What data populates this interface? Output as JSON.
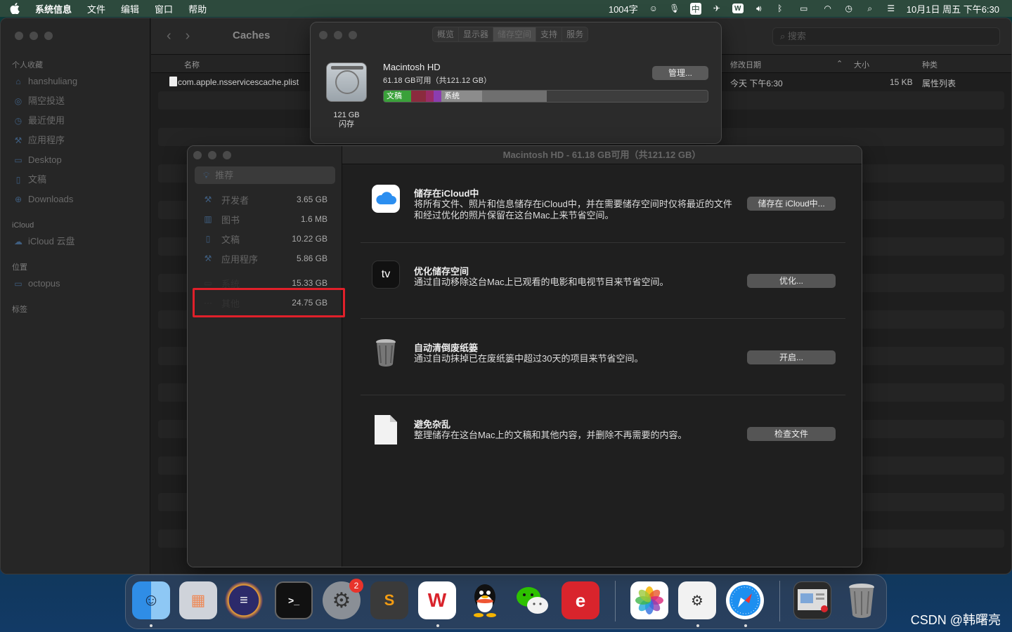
{
  "menubar": {
    "app_name": "系统信息",
    "items": [
      "文件",
      "编辑",
      "窗口",
      "帮助"
    ],
    "status": {
      "word_count": "1004字",
      "input_method": "中",
      "datetime": "10月1日 周五 下午6:30"
    }
  },
  "finder": {
    "title": "Caches",
    "search_placeholder": "搜索",
    "sidebar": {
      "favorites_label": "个人收藏",
      "favorites": [
        {
          "label": "hanshuliang",
          "icon": "home-icon"
        },
        {
          "label": "隔空投送",
          "icon": "airdrop-icon"
        },
        {
          "label": "最近使用",
          "icon": "clock-icon"
        },
        {
          "label": "应用程序",
          "icon": "apps-icon"
        },
        {
          "label": "Desktop",
          "icon": "desktop-icon"
        },
        {
          "label": "文稿",
          "icon": "document-icon"
        },
        {
          "label": "Downloads",
          "icon": "download-icon"
        }
      ],
      "icloud_label": "iCloud",
      "icloud": [
        {
          "label": "iCloud 云盘",
          "icon": "cloud-icon"
        }
      ],
      "locations_label": "位置",
      "locations": [
        {
          "label": "octopus",
          "icon": "computer-icon"
        }
      ],
      "tags_label": "标签"
    },
    "columns": {
      "name": "名称",
      "date": "修改日期",
      "size": "大小",
      "kind": "种类"
    },
    "file": {
      "name": "com.apple.nsservicescache.plist",
      "date": "今天 下午6:30",
      "size": "15 KB",
      "kind": "属性列表"
    }
  },
  "about": {
    "tabs": [
      "概览",
      "显示器",
      "储存空间",
      "支持",
      "服务"
    ],
    "active_tab": "储存空间",
    "disk_capacity": "121 GB",
    "disk_type": "闪存",
    "disk_name": "Macintosh HD",
    "disk_free": "61.18 GB可用（共121.12 GB）",
    "manage_button": "管理...",
    "bar_labels": {
      "documents": "文稿",
      "system": "系统"
    },
    "bar_fractions": {
      "documents": 0.084,
      "other_a": 0.047,
      "other_b": 0.023,
      "purple": 0.024,
      "system": 0.126,
      "apps": 0.2
    },
    "colors": {
      "documents": "#3aa13a",
      "red": "#8b2b3e",
      "pink": "#9a2c66",
      "purple": "#8b3db0",
      "system": "#8c8c8c",
      "apps": "#6f6f6f"
    }
  },
  "storage": {
    "title": "Macintosh HD - 61.18 GB可用（共121.12 GB）",
    "recommended": "推荐",
    "categories": [
      {
        "name": "开发者",
        "size": "3.65 GB",
        "icon": "hammer-icon"
      },
      {
        "name": "图书",
        "size": "1.6 MB",
        "icon": "book-icon"
      },
      {
        "name": "文稿",
        "size": "10.22 GB",
        "icon": "document-icon"
      },
      {
        "name": "应用程序",
        "size": "5.86 GB",
        "icon": "apps-icon"
      },
      {
        "name": "系统",
        "size": "15.33 GB",
        "icon": "system-icon"
      },
      {
        "name": "其他",
        "size": "24.75 GB",
        "icon": "more-icon"
      }
    ],
    "recommendations": [
      {
        "title": "储存在iCloud中",
        "desc": "将所有文件、照片和信息储存在iCloud中，并在需要储存空间时仅将最近的文件和经过优化的照片保留在这台Mac上来节省空间。",
        "button": "储存在 iCloud中...",
        "icon": "icloud-icon"
      },
      {
        "title": "优化储存空间",
        "desc": "通过自动移除这台Mac上已观看的电影和电视节目来节省空间。",
        "button": "优化...",
        "icon": "appletv-icon"
      },
      {
        "title": "自动清倒废纸篓",
        "desc": "通过自动抹掉已在废纸篓中超过30天的项目来节省空间。",
        "button": "开启...",
        "icon": "trash-icon"
      },
      {
        "title": "避免杂乱",
        "desc": "整理储存在这台Mac上的文稿和其他内容，并删除不再需要的内容。",
        "button": "检查文件",
        "icon": "file-icon"
      }
    ],
    "tv_glyph": "tv"
  },
  "dock": {
    "settings_badge": "2",
    "apps": [
      "finder-icon",
      "launchpad-icon",
      "eclipse-icon",
      "terminal-icon",
      "system-preferences-icon",
      "sublime-icon",
      "wps-icon",
      "qq-icon",
      "wechat-icon",
      "expressvpn-icon",
      "photos-icon",
      "system-info-icon",
      "safari-icon",
      "preview-icon",
      "trash-icon"
    ]
  },
  "watermark": "CSDN @韩曙亮"
}
